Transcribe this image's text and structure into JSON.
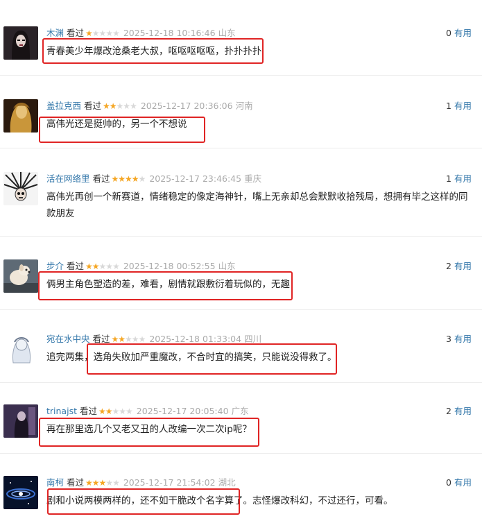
{
  "useful_label": "有用",
  "watched_label": "看过",
  "comments": [
    {
      "user": "木渊",
      "rating": 1,
      "time": "2025-12-18 10:16:46",
      "location": "山东",
      "useful": "0",
      "text": "青春美少年爆改沧桑老大叔，呕呕呕呕呕，扑扑扑扑",
      "avatar": "dark-portrait"
    },
    {
      "user": "盖拉克西",
      "rating": 2,
      "time": "2025-12-17 20:36:06",
      "location": "河南",
      "useful": "1",
      "text": "高伟光还是挺帅的，另一个不想说",
      "avatar": "golden-figure"
    },
    {
      "user": "活在网络里",
      "rating": 4,
      "time": "2025-12-17 23:46:45",
      "location": "重庆",
      "useful": "1",
      "text": "高伟光再创一个新赛道，情绪稳定的像定海神针，嘴上无亲却总会默默收拾残局，想拥有毕之这样的同款朋友",
      "avatar": "spiky-skull"
    },
    {
      "user": "步介",
      "rating": 2,
      "time": "2025-12-18 00:52:55",
      "location": "山东",
      "useful": "2",
      "text": "俩男主角色塑造的差，难看，剧情就跟敷衍着玩似的，无趣",
      "avatar": "dog"
    },
    {
      "user": "宛在水中央",
      "rating": 2,
      "time": "2025-12-18 01:33:04",
      "location": "四川",
      "useful": "3",
      "text": "追完两集，选角失败加严重魔改，不合时宜的搞笑，只能说没得救了。",
      "avatar": "sketch-figure"
    },
    {
      "user": "trinajst",
      "rating": 2,
      "time": "2025-12-17 20:05:40",
      "location": "广东",
      "useful": "2",
      "text": "再在那里选几个又老又丑的人改编一次二次ip呢？",
      "avatar": "purple-figure"
    },
    {
      "user": "南柯",
      "rating": 3,
      "time": "2025-12-17 21:54:02",
      "location": "湖北",
      "useful": "0",
      "text": "剧和小说两模两样的，还不如干脆改个名字算了。志怪爆改科幻，不过还行，可看。",
      "avatar": "galaxy"
    }
  ]
}
